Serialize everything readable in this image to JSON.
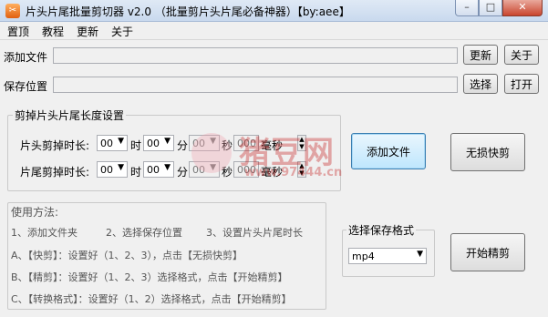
{
  "window": {
    "title": "片头片尾批量剪切器 v2.0 （批量剪片头片尾必备神器）【by:aee】",
    "controls": [
      "minimize-icon",
      "maximize-icon",
      "close-icon"
    ]
  },
  "menu": {
    "items": [
      "置顶",
      "教程",
      "更新",
      "关于"
    ]
  },
  "add_file": {
    "label": "添加文件",
    "value": "",
    "btn_update": "更新",
    "btn_about": "关于"
  },
  "save_location": {
    "label": "保存位置",
    "value": "",
    "btn_select": "选择",
    "btn_open": "打开"
  },
  "trim_group": {
    "title": "剪掉片头片尾长度设置",
    "head": {
      "label": "片头剪掉时长:",
      "hour": "00",
      "hour_unit": "时",
      "min": "00",
      "min_unit": "分",
      "sec": "00",
      "sec_unit": "秒",
      "ms": "000",
      "ms_unit": "毫秒"
    },
    "tail": {
      "label": "片尾剪掉时长:",
      "hour": "00",
      "hour_unit": "时",
      "min": "00",
      "min_unit": "分",
      "sec": "00",
      "sec_unit": "秒",
      "ms": "000",
      "ms_unit": "毫秒"
    }
  },
  "buttons": {
    "add_file": "添加文件",
    "lossless_cut": "无损快剪",
    "start_precise": "开始精剪"
  },
  "usage": {
    "title": "使用方法:",
    "step1": "1、添加文件夹",
    "step2": "2、选择保存位置",
    "step3": "3、设置片头片尾时长",
    "lineA": "A、【快剪】：设置好（1、2、3），点击【无损快剪】",
    "lineB": "B、【精剪】：设置好（1、2、3）选择格式，点击【开始精剪】",
    "lineC": "C、【转换格式】：设置好（1、2）选择格式，点击【开始精剪】"
  },
  "format": {
    "title": "选择保存格式",
    "selected": "mp4"
  },
  "watermark": {
    "text": "猪豆网",
    "url": "www.97444.cn"
  },
  "colors": {
    "accent_focus": "#3c7fb1",
    "watermark": "#c31818",
    "title_gradient_top": "#dfe9f5"
  }
}
